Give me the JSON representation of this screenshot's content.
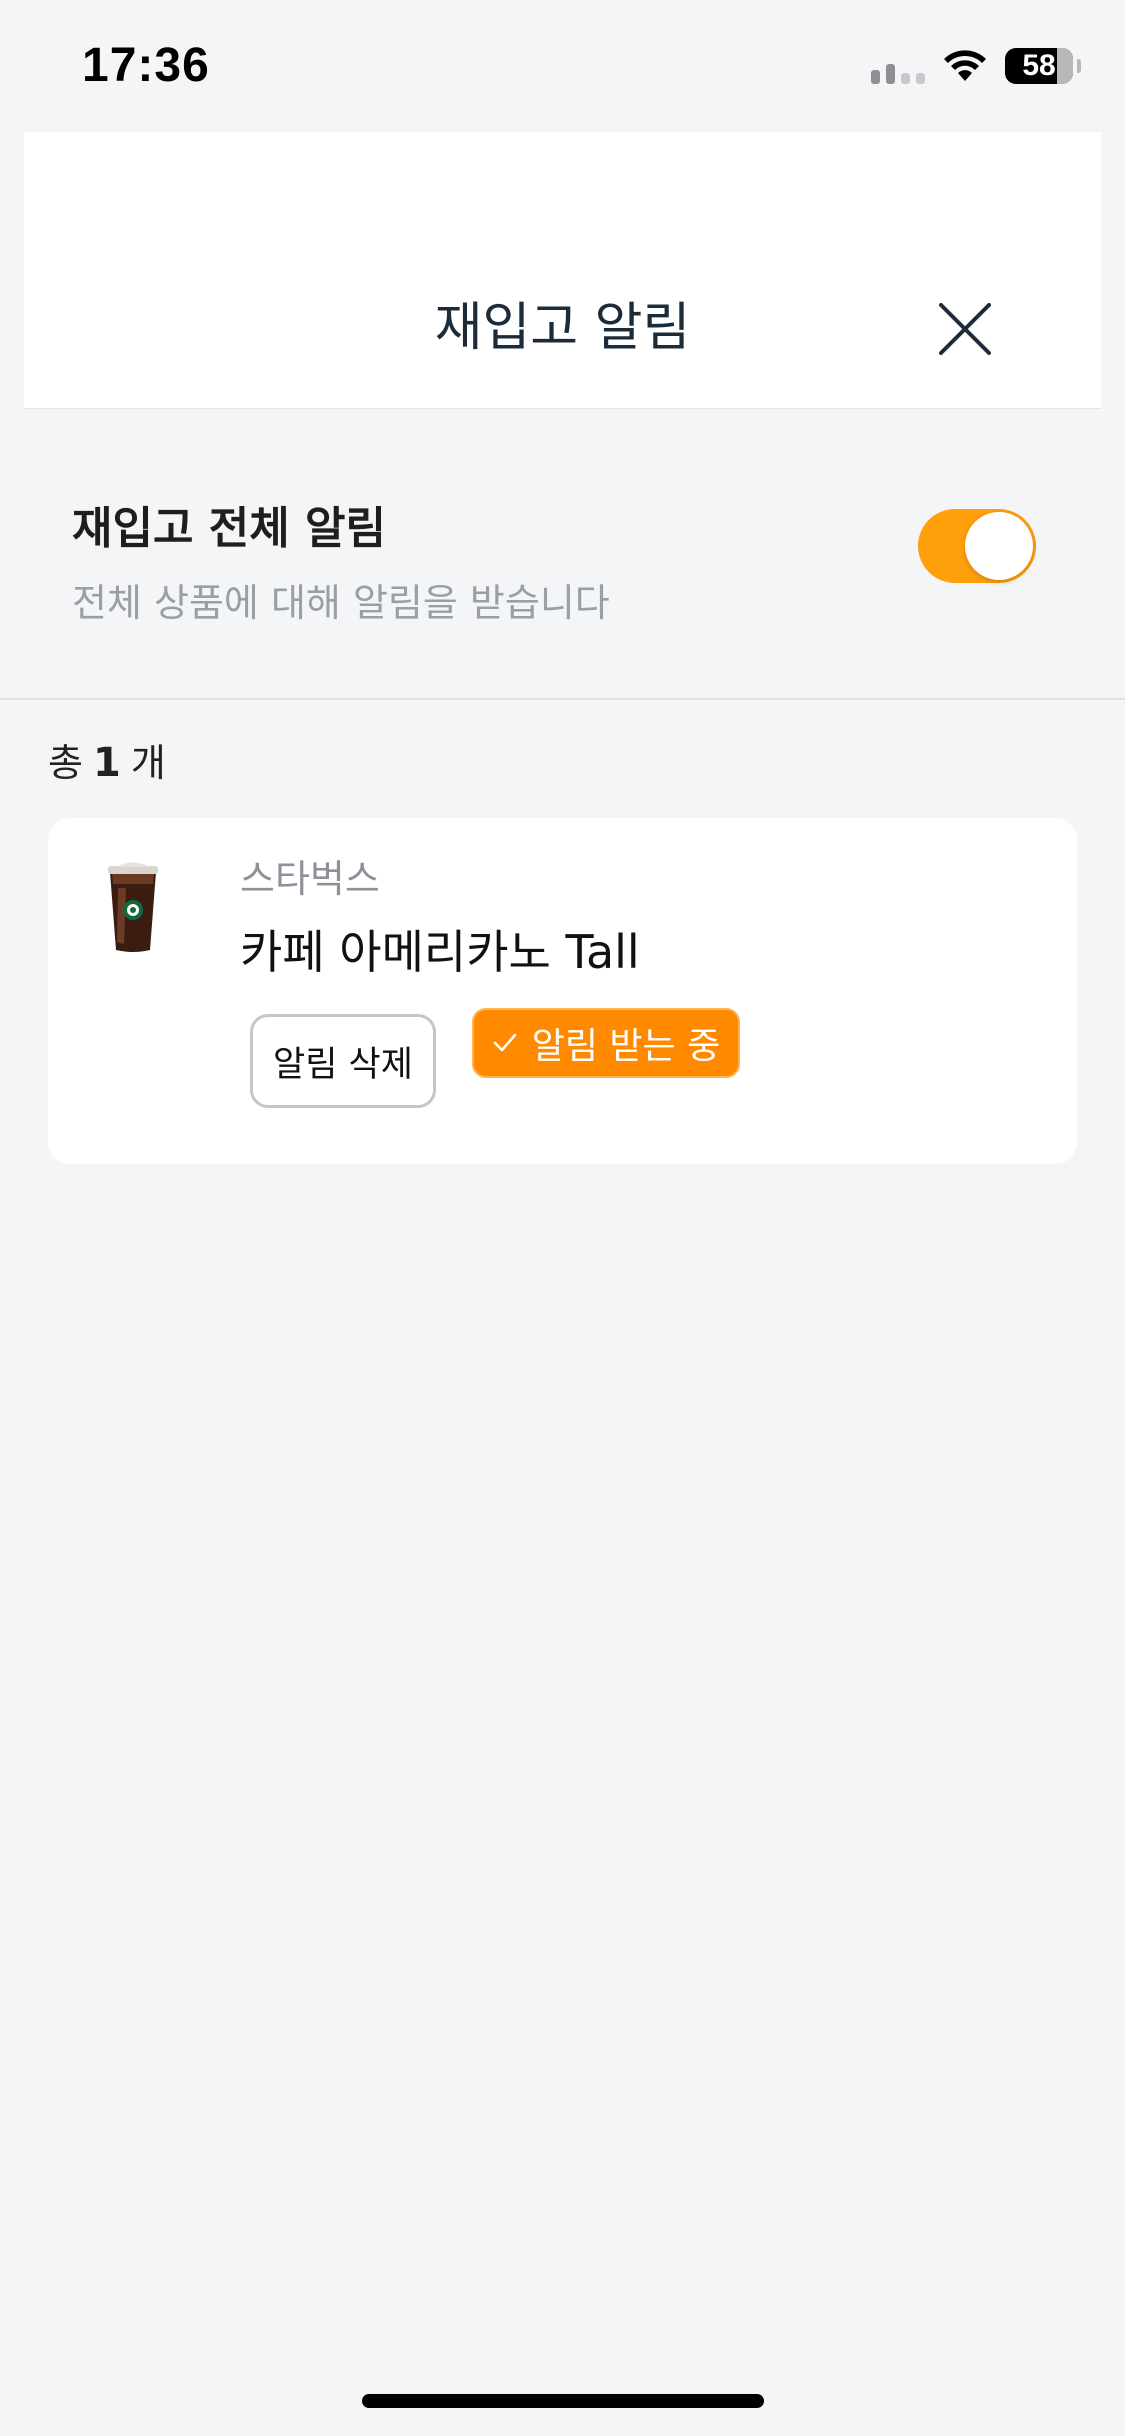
{
  "status_bar": {
    "time": "17:36",
    "battery": "58"
  },
  "header": {
    "title": "재입고 알림",
    "close_icon": "close-icon"
  },
  "restock_all": {
    "title": "재입고 전체 알림",
    "subtitle": "전체 상품에 대해 알림을 받습니다",
    "toggle_on": true
  },
  "count": {
    "prefix": "총",
    "value": "1",
    "suffix": "개"
  },
  "items": [
    {
      "brand": "스타벅스",
      "name": "카페 아메리카노 Tall",
      "delete_label": "알림 삭제",
      "active_label": "알림 받는 중",
      "check_icon": "check-icon",
      "image_icon": "iced-coffee-cup-icon"
    }
  ],
  "colors": {
    "accent": "#ff9f0a",
    "active_button": "#ff8a00",
    "title": "#1c2b3a",
    "background": "#f4f5f7"
  }
}
